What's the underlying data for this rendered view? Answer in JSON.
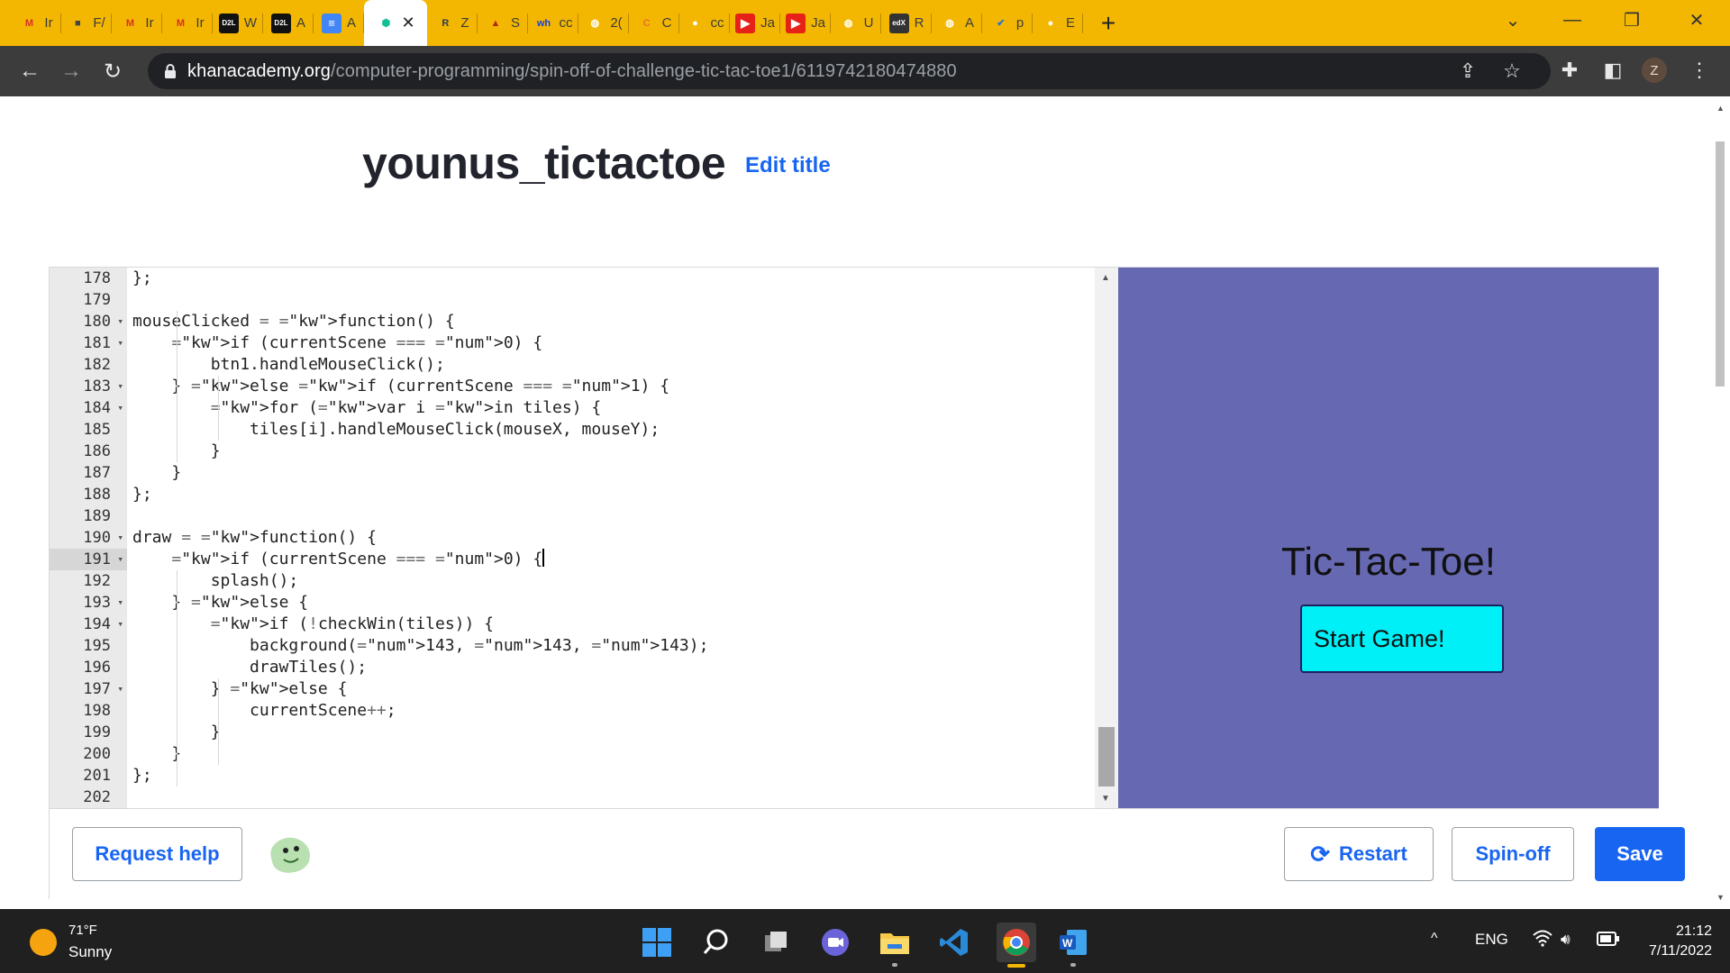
{
  "browser": {
    "tabs": [
      {
        "icon": "gmail-icon",
        "label": "Ir"
      },
      {
        "icon": "cube-icon",
        "label": "F/"
      },
      {
        "icon": "gmail-icon",
        "label": "Ir"
      },
      {
        "icon": "gmail-icon",
        "label": "Ir"
      },
      {
        "icon": "d2l-icon",
        "label": "W"
      },
      {
        "icon": "d2l-icon",
        "label": "A"
      },
      {
        "icon": "docs-icon",
        "label": "A"
      },
      {
        "icon": "khan-academy-icon",
        "label": ""
      },
      {
        "icon": "r-icon",
        "label": "Z"
      },
      {
        "icon": "triangle-icon",
        "label": "S"
      },
      {
        "icon": "wh-icon",
        "label": "cc"
      },
      {
        "icon": "globe-icon",
        "label": "2("
      },
      {
        "icon": "c-icon",
        "label": "C"
      },
      {
        "icon": "github-icon",
        "label": "cc"
      },
      {
        "icon": "youtube-icon",
        "label": "Ja"
      },
      {
        "icon": "youtube-icon",
        "label": "Ja"
      },
      {
        "icon": "globe-icon",
        "label": "U"
      },
      {
        "icon": "edx-icon",
        "label": "R"
      },
      {
        "icon": "globe-icon",
        "label": "A"
      },
      {
        "icon": "bird-icon",
        "label": "p"
      },
      {
        "icon": "github-icon",
        "label": "E"
      }
    ],
    "url_host": "khanacademy.org",
    "url_path": "/computer-programming/spin-off-of-challenge-tic-tac-toe1/6119742180474880",
    "profile_initial": "Z"
  },
  "page": {
    "title": "younus_tictactoe",
    "edit_title_label": "Edit title"
  },
  "editor": {
    "active_line": 191,
    "lines": [
      {
        "n": "178",
        "fold": false,
        "code": "};"
      },
      {
        "n": "179",
        "fold": false,
        "code": ""
      },
      {
        "n": "180",
        "fold": true,
        "code": "mouseClicked = function() {"
      },
      {
        "n": "181",
        "fold": true,
        "code": "    if (currentScene === 0) {"
      },
      {
        "n": "182",
        "fold": false,
        "code": "        btn1.handleMouseClick();"
      },
      {
        "n": "183",
        "fold": true,
        "code": "    } else if (currentScene === 1) {"
      },
      {
        "n": "184",
        "fold": true,
        "code": "        for (var i in tiles) {"
      },
      {
        "n": "185",
        "fold": false,
        "code": "            tiles[i].handleMouseClick(mouseX, mouseY);"
      },
      {
        "n": "186",
        "fold": false,
        "code": "        }"
      },
      {
        "n": "187",
        "fold": false,
        "code": "    }"
      },
      {
        "n": "188",
        "fold": false,
        "code": "};"
      },
      {
        "n": "189",
        "fold": false,
        "code": ""
      },
      {
        "n": "190",
        "fold": true,
        "code": "draw = function() {"
      },
      {
        "n": "191",
        "fold": true,
        "code": "    if (currentScene === 0) {"
      },
      {
        "n": "192",
        "fold": false,
        "code": "        splash();"
      },
      {
        "n": "193",
        "fold": true,
        "code": "    } else {"
      },
      {
        "n": "194",
        "fold": true,
        "code": "        if (!checkWin(tiles)) {"
      },
      {
        "n": "195",
        "fold": false,
        "code": "            background(143, 143, 143);"
      },
      {
        "n": "196",
        "fold": false,
        "code": "            drawTiles();"
      },
      {
        "n": "197",
        "fold": true,
        "code": "        } else {"
      },
      {
        "n": "198",
        "fold": false,
        "code": "            currentScene++;"
      },
      {
        "n": "199",
        "fold": false,
        "code": "        }"
      },
      {
        "n": "200",
        "fold": false,
        "code": "    }"
      },
      {
        "n": "201",
        "fold": false,
        "code": "};"
      },
      {
        "n": "202",
        "fold": false,
        "code": ""
      }
    ]
  },
  "canvas": {
    "heading": "Tic-Tac-Toe!",
    "start_button": "Start Game!",
    "background_color": "#6669b2",
    "button_color": "#00f0f8"
  },
  "footer": {
    "request_help": "Request help",
    "restart": "Restart",
    "spin_off": "Spin-off",
    "save": "Save"
  },
  "taskbar": {
    "temperature": "71°F",
    "condition": "Sunny",
    "language": "ENG",
    "time": "21:12",
    "date": "7/11/2022"
  },
  "colors": {
    "tab_strip": "#f3b702",
    "accent_blue": "#1865f2"
  }
}
